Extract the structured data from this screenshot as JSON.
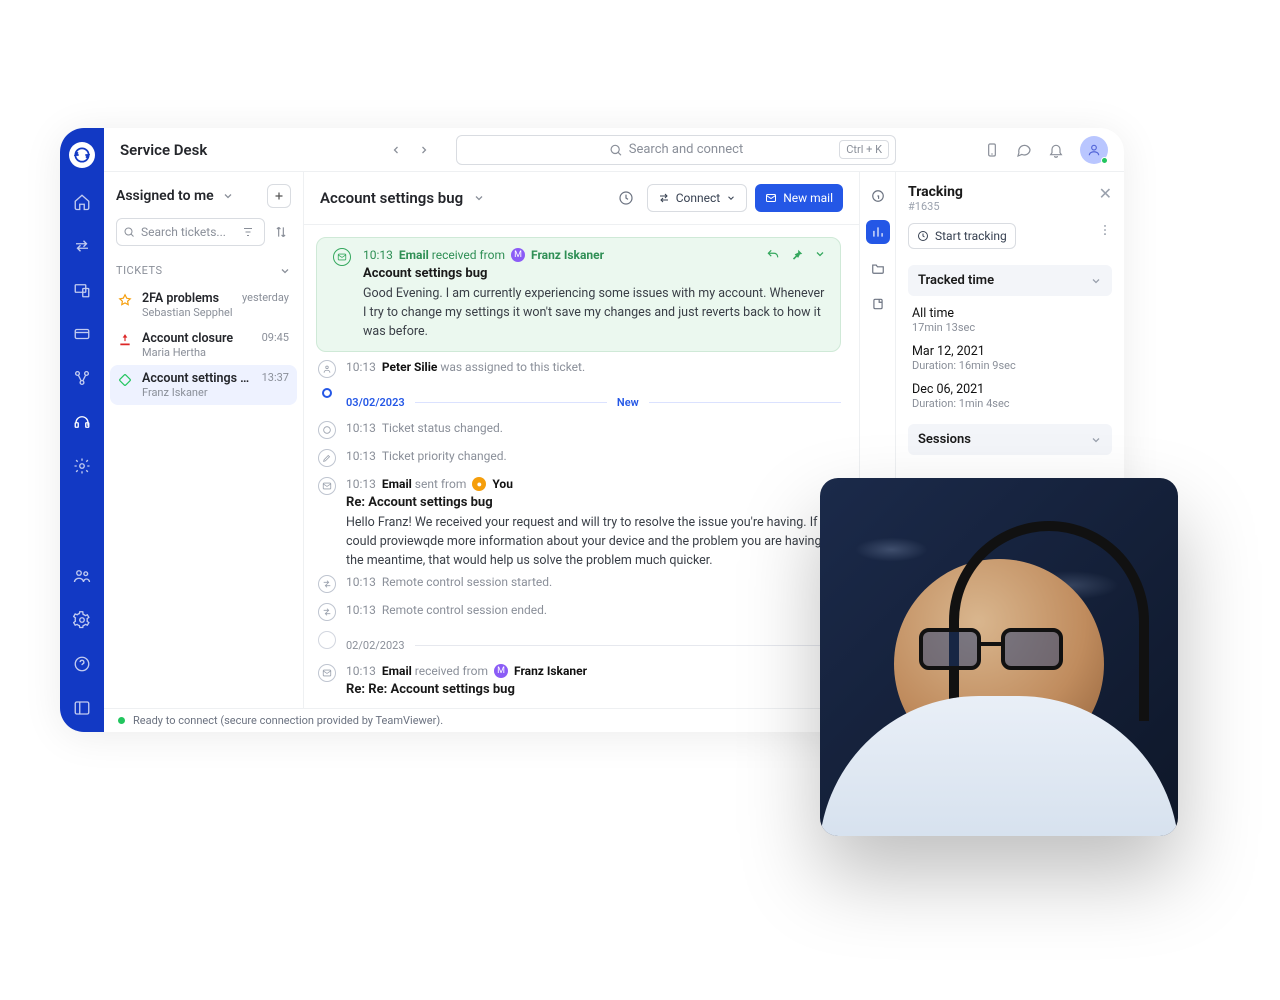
{
  "header": {
    "app_title": "Service Desk",
    "search_placeholder": "Search and connect",
    "shortcut": "Ctrl + K"
  },
  "ticket_list": {
    "filter_title": "Assigned to me",
    "search_placeholder": "Search tickets...",
    "section": "TICKETS",
    "items": [
      {
        "title": "2FA problems",
        "sub": "Sebastian Sepphel",
        "time": "yesterday"
      },
      {
        "title": "Account closure",
        "sub": "Maria Hertha",
        "time": "09:45"
      },
      {
        "title": "Account settings bug",
        "sub": "Franz Iskaner",
        "time": "13:37"
      }
    ]
  },
  "thread": {
    "title": "Account settings bug",
    "connect_label": "Connect",
    "newmail_label": "New mail"
  },
  "timeline": {
    "head": {
      "time": "10:13",
      "type_word": "Email",
      "verb": " received from",
      "author": "Franz Iskaner",
      "subject": "Account settings bug",
      "body": "Good Evening. I am currently experiencing some issues with my account. Whenever I try to change my settings it won't save my changes and just reverts back to how it was before."
    },
    "assigned": {
      "time": "10:13",
      "who": "Peter Silie",
      "tail": " was assigned to this ticket."
    },
    "divider1": {
      "date": "03/02/2023",
      "label": "New"
    },
    "status": {
      "time": "10:13",
      "text": "Ticket status changed."
    },
    "priority": {
      "time": "10:13",
      "text": "Ticket priority changed."
    },
    "reply": {
      "time": "10:13",
      "type_word": "Email",
      "verb": " sent from",
      "author": "You",
      "subject": "Re: Account settings bug",
      "body": "Hello Franz! We received your request and will try to resolve the issue you're having.  If you could proviewqde more information about your device and the problem you are having in the meantime, that would help us solve the problem much quicker."
    },
    "rc_start": {
      "time": "10:13",
      "text": "Remote control session started."
    },
    "rc_end": {
      "time": "10:13",
      "text": "Remote control session ended."
    },
    "divider2": {
      "date": "02/02/2023"
    },
    "head2": {
      "time": "10:13",
      "type_word": "Email",
      "verb": " received from",
      "author": "Franz Iskaner",
      "subject": "Re: Re: Account settings bug"
    }
  },
  "tracking": {
    "title": "Tracking",
    "ticket_id": "#1635",
    "start_label": "Start tracking",
    "acc1": "Tracked time",
    "alltime_label": "All time",
    "alltime_value": "17min 13sec",
    "entries": [
      {
        "date": "Mar 12, 2021",
        "dur": "Duration: 16min 9sec"
      },
      {
        "date": "Dec 06, 2021",
        "dur": "Duration: 1min 4sec"
      }
    ],
    "acc2": "Sessions"
  },
  "statusbar": "Ready to connect (secure connection provided by TeamViewer)."
}
